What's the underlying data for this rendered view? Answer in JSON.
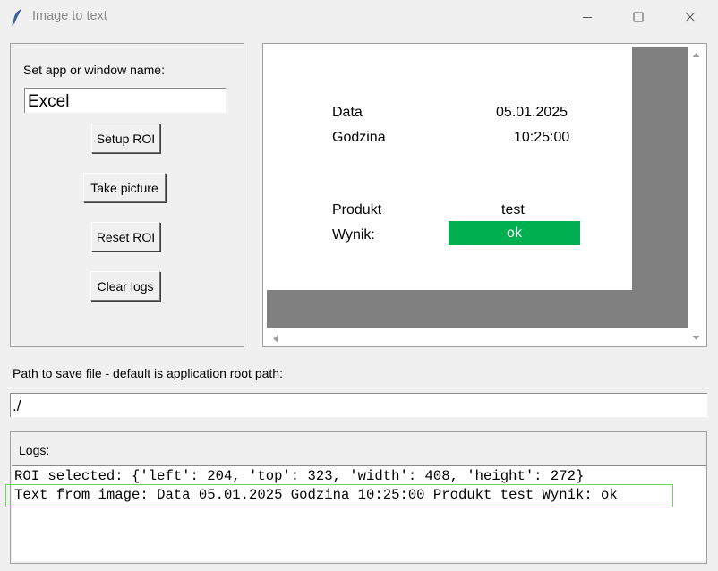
{
  "window": {
    "title": "Image to text",
    "app_icon": "feather-icon",
    "controls": [
      "minimize-icon",
      "maximize-icon",
      "close-icon"
    ]
  },
  "settings": {
    "app_name_label": "Set app or window name:",
    "app_name_value": "Excel",
    "buttons": {
      "setup_roi": "Setup ROI",
      "take_picture": "Take picture",
      "reset_roi": "Reset ROI",
      "clear_logs": "Clear logs"
    }
  },
  "preview": {
    "data_label": "Data",
    "data_value": "05.01.2025",
    "godzina_label": "Godzina",
    "godzina_value": "10:25:00",
    "produkt_label": "Produkt",
    "produkt_value": "test",
    "wynik_label": "Wynik:",
    "wynik_value": "ok",
    "wynik_color": "#00b050",
    "scroll_icons": [
      "arrow-up-icon",
      "arrow-down-icon",
      "arrow-left-icon"
    ]
  },
  "path": {
    "label": "Path to save file - default is application root path:",
    "value": "./"
  },
  "logs": {
    "label": "Logs:",
    "lines": [
      "ROI selected: {'left': 204, 'top': 323, 'width': 408, 'height': 272}",
      "Text from image: Data 05.01.2025 Godzina 10:25:00 Produkt test Wynik: ok"
    ],
    "highlight_color": "#66dd55"
  }
}
